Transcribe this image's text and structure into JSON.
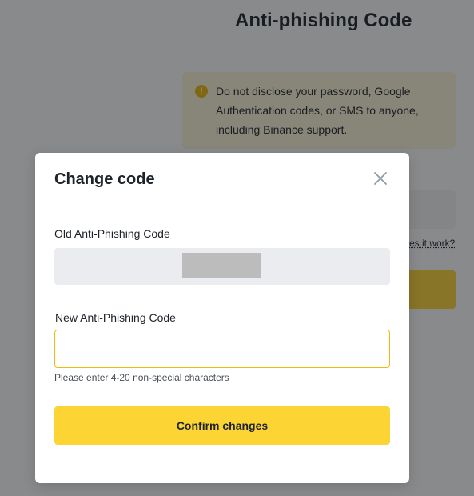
{
  "background": {
    "page_title": "Anti-phishing Code",
    "warning_text": "Do not disclose your password, Google Authentication codes, or SMS to anyone, including Binance support.",
    "help_link": "es it work?"
  },
  "modal": {
    "title": "Change code",
    "old_label": "Old Anti-Phishing Code",
    "new_label": "New Anti-Phishing Code",
    "new_value": "",
    "new_placeholder": "",
    "hint": "Please enter 4-20 non-special characters",
    "confirm_label": "Confirm changes"
  },
  "colors": {
    "accent": "#fcd535",
    "input_border_focus": "#f0b90b",
    "warning_bg": "#fdf6d6",
    "overlay": "rgba(20,21,26,0.5)"
  },
  "icons": {
    "close": "close-icon",
    "warning": "warning-icon"
  }
}
